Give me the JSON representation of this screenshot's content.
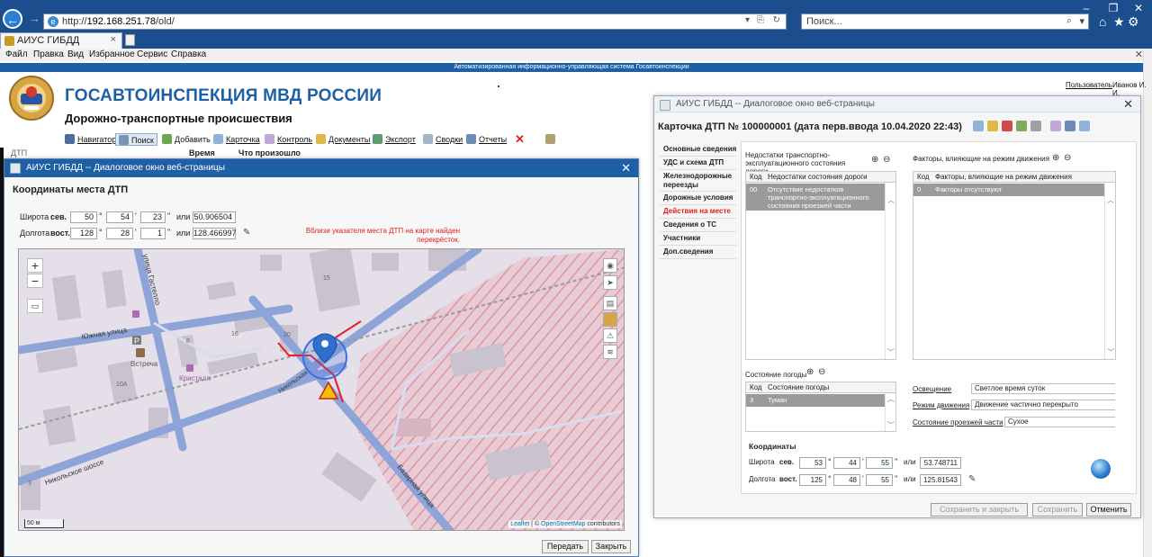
{
  "browser": {
    "url_prefix": "http://",
    "url_host": "192.168.251.78",
    "url_path": "/old/",
    "search_placeholder": "Поиск...",
    "tab_label": "АИУС ГИБДД",
    "menu": [
      "Файл",
      "Правка",
      "Вид",
      "Избранное",
      "Сервис",
      "Справка"
    ]
  },
  "system_bar": "Автоматизированная информационно-управляющая система Госавтоинспекции",
  "app": {
    "title": "ГОСАВТОИНСПЕКЦИЯ МВД РОССИИ",
    "subtitle": "Дорожно-транспортные происшествия",
    "user_link": "Пользователь",
    "user_name": "Иванов И. И.",
    "toolbar": [
      "Навигатор",
      "Поиск",
      "Добавить",
      "Карточка",
      "Контроль",
      "Документы",
      "Экспорт",
      "Сводки",
      "Отчеты"
    ],
    "list_columns": [
      "Время",
      "Что произошло"
    ],
    "list_left_hint": "ДТП"
  },
  "coord_dialog": {
    "title": "АИУС ГИБДД -- Диалоговое окно веб-страницы",
    "heading": "Координаты места ДТП",
    "lat_label": "Широта",
    "lat_dir": "сев.",
    "lat_deg": "50",
    "lat_min": "54",
    "lat_sec": "23",
    "or": "или",
    "lat_decimal": "50.906504",
    "lon_label": "Долгота",
    "lon_dir": "вост.",
    "lon_deg": "128",
    "lon_min": "28",
    "lon_sec": "1",
    "lon_decimal": "128.466997",
    "warning": "Вблизи указателя места ДТП на карте найден перекрёсток.",
    "map": {
      "zoom_in": "+",
      "zoom_out": "−",
      "streets": [
        "Южная улица",
        "Никольское шоссе",
        "Базарная улица",
        "Никольская",
        "улица Гастелло"
      ],
      "pois": [
        "Встреча",
        "Кристалл"
      ],
      "house_numbers": [
        "16",
        "20",
        "15",
        "10А",
        "3",
        "8"
      ],
      "scale": "50 м",
      "attribution_leaflet": "Leaflet",
      "attribution_sep": " | © ",
      "attribution_osm": "OpenStreetMap",
      "attribution_tail": " contributors"
    },
    "btn_send": "Передать",
    "btn_close": "Закрыть"
  },
  "card_dialog": {
    "title": "АИУС ГИБДД -- Диалоговое окно веб-страницы",
    "heading": "Карточка ДТП № 100000001 (дата перв.ввода 10.04.2020 22:43)",
    "sidebar": [
      "Основные сведения",
      "УДС и схема ДТП",
      "Железнодорожные переезды",
      "Дорожные условия",
      "Действия на месте",
      "Сведения о ТС",
      "Участники",
      "Доп.сведения"
    ],
    "sidebar_active_index": 4,
    "road_defects": {
      "title": "Недостатки транспортно-эксплуатационного состояния дороги",
      "col_code": "Код",
      "col_name": "Недостатки состояния дороги",
      "row_code": "00",
      "row_name": "Отсутствие недостатков транспортно-эксплуатационного состояния проезжей части"
    },
    "traffic_factors": {
      "title": "Факторы, влияющие на режим движения",
      "col_code": "Код",
      "col_name": "Факторы, влияющие на режим движения",
      "row_code": "0",
      "row_name": "Факторы отсутствуют"
    },
    "weather": {
      "title": "Состояние погоды",
      "col_code": "Код",
      "col_name": "Состояние погоды",
      "row_code": "3",
      "row_name": "Туман"
    },
    "lighting_label": "Освещение",
    "lighting_value": "Светлое время суток",
    "traffic_mode_label": "Режим движения",
    "traffic_mode_value": "Движение частично перекрыто",
    "surface_label": "Состояние проезжей части",
    "surface_value": "Сухое",
    "coords_heading": "Координаты",
    "lat_label": "Широта",
    "lat_dir": "сев.",
    "lat_deg": "53",
    "lat_min": "44",
    "lat_sec": "55",
    "or": "или",
    "lat_decimal": "53.748711",
    "lon_label": "Долгота",
    "lon_dir": "вост.",
    "lon_deg": "125",
    "lon_min": "48",
    "lon_sec": "55",
    "lon_decimal": "125.81543",
    "btn_save_close": "Сохранить и закрыть",
    "btn_save": "Сохранить",
    "btn_cancel": "Отменить"
  },
  "colors": {
    "chrome_blue": "#1c4d8c",
    "title_blue": "#1f5fa6",
    "warning_red": "#e02020",
    "map_hatch": "#e7a8b6",
    "road_blue": "#8ea4d8"
  },
  "icons": [
    "back-arrow-icon",
    "forward-arrow-icon",
    "search-icon",
    "home-icon",
    "star-icon",
    "gear-icon",
    "map-marker-icon",
    "warning-sign-icon",
    "globe-icon",
    "eraser-icon"
  ]
}
